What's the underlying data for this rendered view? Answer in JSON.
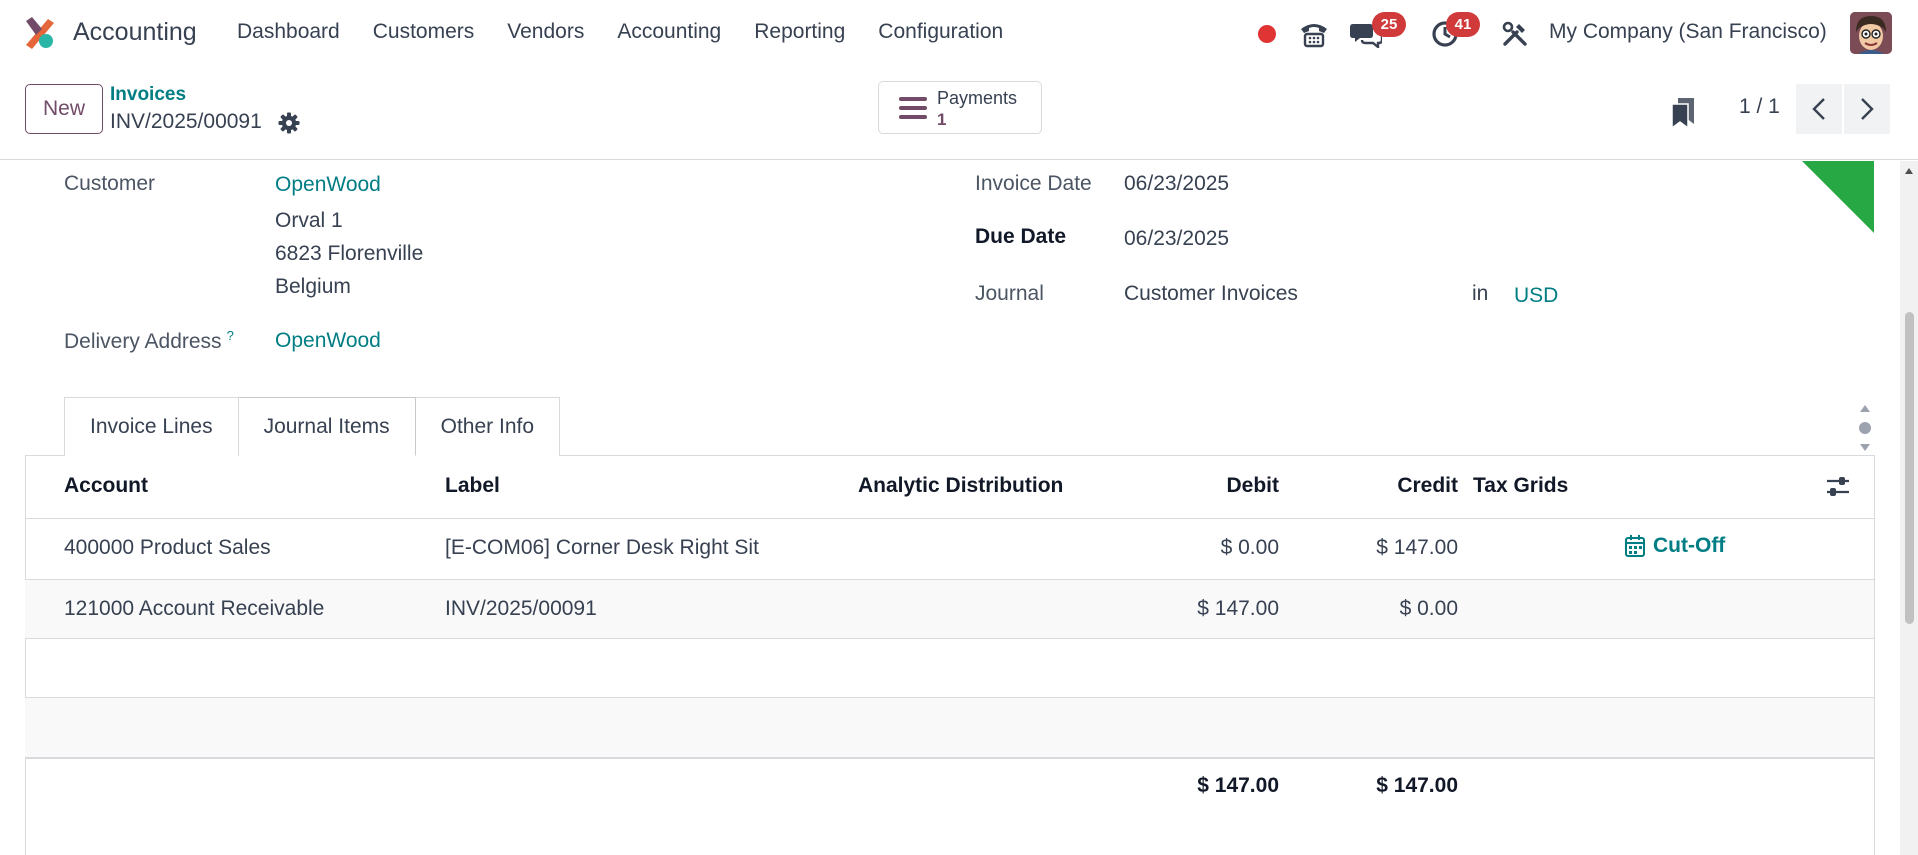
{
  "app": {
    "name": "Accounting",
    "menu": [
      "Dashboard",
      "Customers",
      "Vendors",
      "Accounting",
      "Reporting",
      "Configuration"
    ],
    "messages_badge": "25",
    "activities_badge": "41",
    "company": "My Company (San Francisco)",
    "colors": {
      "accent": "#714b67",
      "link": "#017e84",
      "badge": "#d13a3a",
      "paid_ribbon": "#28a745"
    }
  },
  "control": {
    "new_label": "New",
    "breadcrumb_parent": "Invoices",
    "breadcrumb_current": "INV/2025/00091",
    "payments_label": "Payments",
    "payments_count": "1",
    "pager": "1 / 1"
  },
  "form": {
    "customer_label": "Customer",
    "customer_name": "OpenWood",
    "address_line1": "Orval 1",
    "address_line2": "6823 Florenville",
    "address_line3": "Belgium",
    "delivery_label": "Delivery Address",
    "delivery_help": "?",
    "delivery_value": "OpenWood",
    "invoice_date_label": "Invoice Date",
    "invoice_date": "06/23/2025",
    "due_date_label": "Due Date",
    "due_date": "06/23/2025",
    "journal_label": "Journal",
    "journal_value": "Customer Invoices",
    "journal_in": "in",
    "currency": "USD"
  },
  "tabs": [
    "Invoice Lines",
    "Journal Items",
    "Other Info"
  ],
  "table": {
    "headers": {
      "account": "Account",
      "label": "Label",
      "analytic": "Analytic Distribution",
      "debit": "Debit",
      "credit": "Credit",
      "tax_grids": "Tax Grids"
    },
    "rows": [
      {
        "account": "400000 Product Sales",
        "label": "[E-COM06] Corner Desk Right Sit",
        "debit": "$ 0.00",
        "credit": "$ 147.00",
        "action": "Cut-Off"
      },
      {
        "account": "121000 Account Receivable",
        "label": "INV/2025/00091",
        "debit": "$ 147.00",
        "credit": "$ 0.00",
        "action": ""
      }
    ],
    "total_debit": "$ 147.00",
    "total_credit": "$ 147.00"
  }
}
